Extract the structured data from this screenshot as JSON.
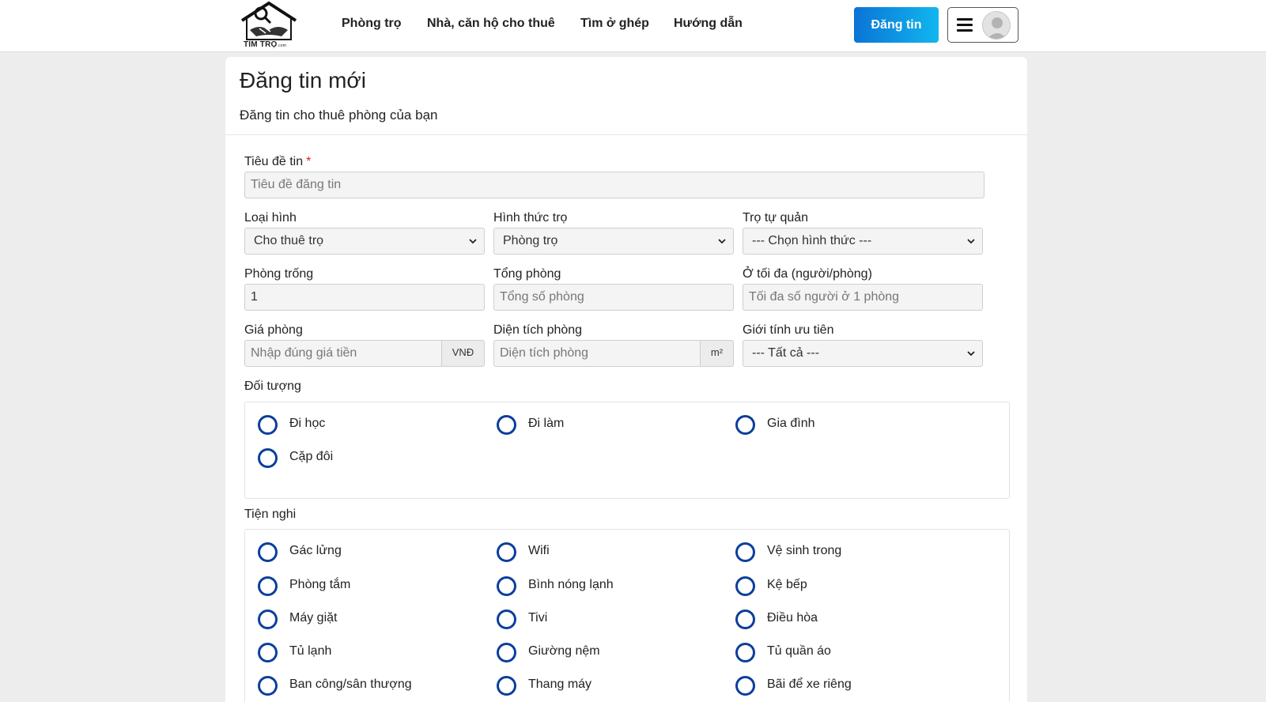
{
  "header": {
    "logo_text": "TÌM TRỌ",
    "logo_suffix": ".com",
    "nav": [
      "Phòng trọ",
      "Nhà, căn hộ cho thuê",
      "Tìm ở ghép",
      "Hướng dẫn"
    ],
    "post_button": "Đăng tin"
  },
  "page": {
    "title": "Đăng tin mới",
    "subtitle": "Đăng tin cho thuê phòng của bạn"
  },
  "form": {
    "title_label": "Tiêu đề tin",
    "required_mark": "*",
    "title_placeholder": "Tiêu đề đăng tin",
    "type_label": "Loại hình",
    "type_value": "Cho thuê trọ",
    "form_label": "Hình thức trọ",
    "form_value": "Phòng trọ",
    "self_label": "Trọ tự quản",
    "self_value": "--- Chọn hình thức ---",
    "empty_label": "Phòng trống",
    "empty_value": "1",
    "total_label": "Tổng phòng",
    "total_placeholder": "Tổng số phòng",
    "max_label": "Ở tối đa (người/phòng)",
    "max_placeholder": "Tối đa số người ở 1 phòng",
    "price_label": "Giá phòng",
    "price_placeholder": "Nhập đúng giá tiền",
    "price_unit": "VNĐ",
    "area_label": "Diện tích phòng",
    "area_placeholder": "Diện tích phòng",
    "area_unit": "m²",
    "gender_label": "Giới tính ưu tiên",
    "gender_value": "--- Tất cả ---",
    "audience_label": "Đối tượng",
    "audience": [
      "Đi học",
      "Đi làm",
      "Gia đình",
      "Cặp đôi"
    ],
    "amenities_label": "Tiện nghi",
    "amenities": [
      "Gác lửng",
      "Wifi",
      "Vệ sinh trong",
      "Phòng tắm",
      "Bình nóng lạnh",
      "Kệ bếp",
      "Máy giặt",
      "Tivi",
      "Điều hòa",
      "Tủ lạnh",
      "Giường nệm",
      "Tủ quần áo",
      "Ban công/sân thượng",
      "Thang máy",
      "Bãi để xe riêng"
    ]
  },
  "colors": {
    "radio_ring": "#0b3f9c",
    "post_button_start": "#0a74d6",
    "post_button_end": "#12b6ee"
  }
}
